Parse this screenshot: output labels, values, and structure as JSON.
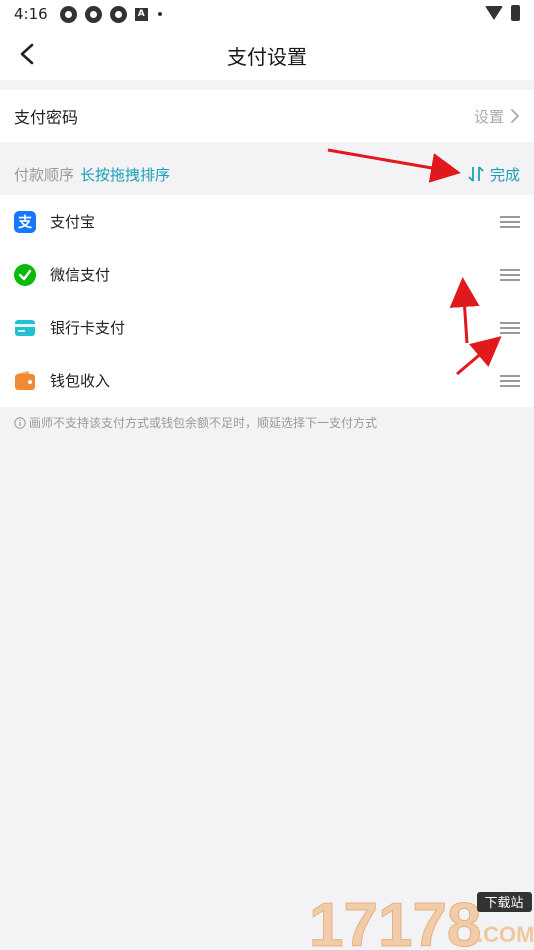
{
  "status_bar": {
    "time": "4:16"
  },
  "header": {
    "title": "支付设置"
  },
  "password_row": {
    "label": "支付密码",
    "action": "设置"
  },
  "order_section": {
    "label": "付款顺序",
    "hint": "长按拖拽排序",
    "done": "完成"
  },
  "payment_methods": [
    {
      "label": "支付宝",
      "icon": "alipay-icon",
      "color": "#1677ff"
    },
    {
      "label": "微信支付",
      "icon": "wechat-pay-icon",
      "color": "#09bb07"
    },
    {
      "label": "银行卡支付",
      "icon": "bank-card-icon",
      "color": "#21c2cf"
    },
    {
      "label": "钱包收入",
      "icon": "wallet-icon",
      "color": "#f08a34"
    }
  ],
  "tip": "画师不支持该支付方式或钱包余额不足时，顺延选择下一支付方式",
  "watermark": {
    "text": "17178",
    "badge": "下载站",
    "domain": ".COM"
  },
  "colors": {
    "accent": "#1aa0b8",
    "annotation_arrow": "#e0191d"
  }
}
